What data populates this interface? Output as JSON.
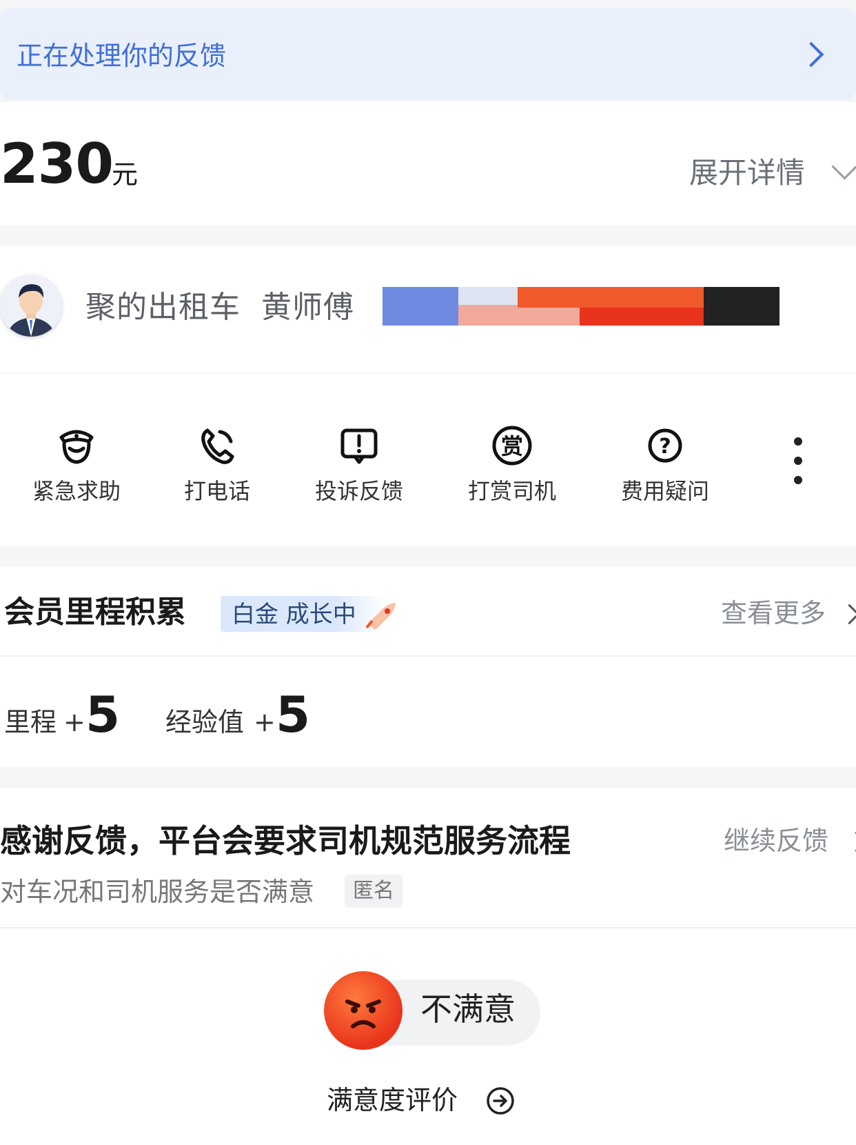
{
  "banner": {
    "text": "正在处理你的反馈"
  },
  "fare": {
    "amount": "230",
    "unit": "元",
    "expand_label": "展开详情"
  },
  "driver": {
    "company": "聚的出租车",
    "name": "黄师傅"
  },
  "actions": [
    {
      "label": "紧急求助",
      "icon": "police-shield-icon"
    },
    {
      "label": "打电话",
      "icon": "phone-icon"
    },
    {
      "label": "投诉反馈",
      "icon": "complaint-icon"
    },
    {
      "label": "打赏司机",
      "icon": "tip-icon"
    },
    {
      "label": "费用疑问",
      "icon": "question-icon"
    }
  ],
  "membership": {
    "title": "会员里程积累",
    "badge": "白金 成长中",
    "see_more": "查看更多",
    "mileage_label": "里程",
    "mileage_value": "5",
    "exp_label": "经验值",
    "exp_value": "5",
    "plus": "+"
  },
  "feedback": {
    "title": "感谢反馈，平台会要求司机规范服务流程",
    "continue": "继续反馈",
    "question": "对车况和司机服务是否满意",
    "anonymous": "匿名",
    "selected": "不满意",
    "rate_label": "满意度评价"
  },
  "colors": {
    "accent": "#3f6fd8",
    "banner_bg": "#e9effb",
    "angry_face": "#e8341c"
  }
}
